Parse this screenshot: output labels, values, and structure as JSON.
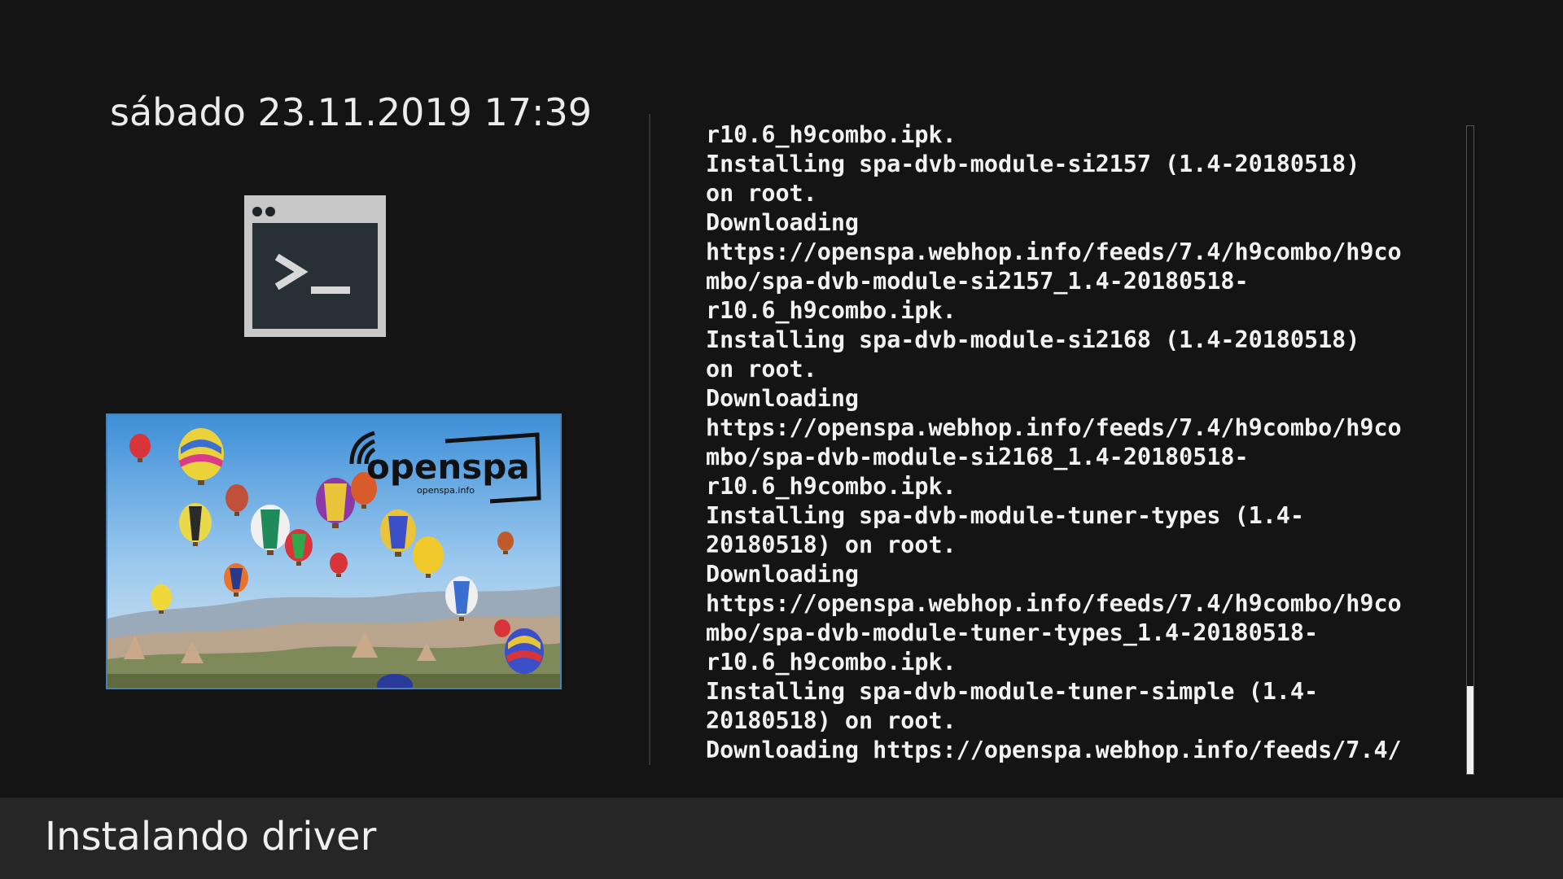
{
  "header": {
    "datetime": "sábado 23.11.2019 17:39"
  },
  "icons": {
    "terminal": "terminal-icon"
  },
  "image": {
    "logo_text": "openspa",
    "logo_url": "openspa.info"
  },
  "log": {
    "lines": [
      "r10.6_h9combo.ipk.",
      "Installing spa-dvb-module-si2157 (1.4-20180518)",
      "on root.",
      "Downloading",
      "https://openspa.webhop.info/feeds/7.4/h9combo/h9co",
      "mbo/spa-dvb-module-si2157_1.4-20180518-",
      "r10.6_h9combo.ipk.",
      "Installing spa-dvb-module-si2168 (1.4-20180518)",
      "on root.",
      "Downloading",
      "https://openspa.webhop.info/feeds/7.4/h9combo/h9co",
      "mbo/spa-dvb-module-si2168_1.4-20180518-",
      "r10.6_h9combo.ipk.",
      "Installing spa-dvb-module-tuner-types (1.4-",
      "20180518) on root.",
      "Downloading",
      "https://openspa.webhop.info/feeds/7.4/h9combo/h9co",
      "mbo/spa-dvb-module-tuner-types_1.4-20180518-",
      "r10.6_h9combo.ipk.",
      "Installing spa-dvb-module-tuner-simple (1.4-",
      "20180518) on root.",
      "Downloading https://openspa.webhop.info/feeds/7.4/"
    ],
    "scroll_position": 1.0
  },
  "footer": {
    "title": "Instalando driver"
  }
}
